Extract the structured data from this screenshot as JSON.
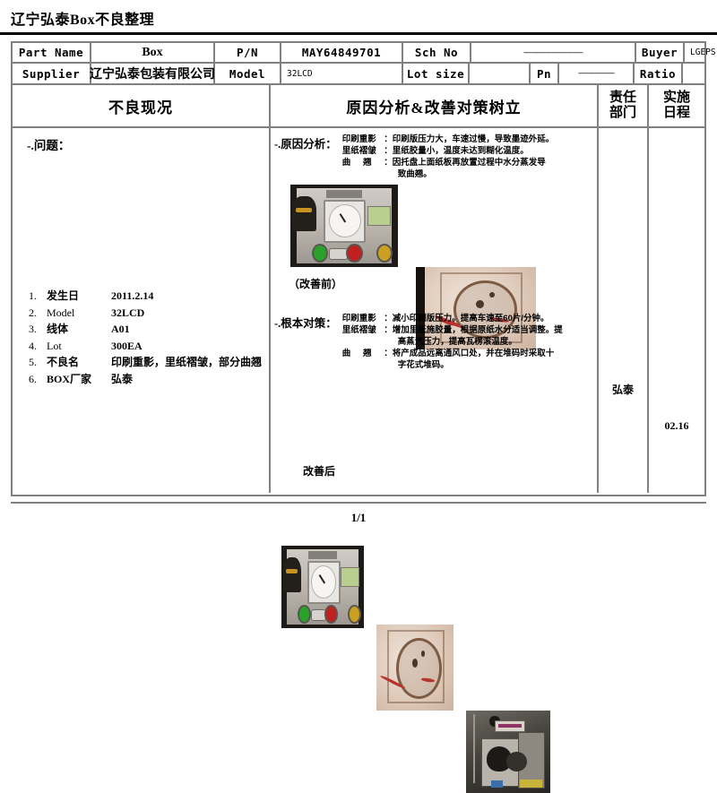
{
  "document": {
    "title": "辽宁弘泰Box不良整理",
    "page_number": "1/1"
  },
  "header": {
    "part_name_label": "Part Name",
    "part_name_value": "Box",
    "pn_label": "P/N",
    "pn_value": "MAY64849701",
    "sch_no_label": "Sch No",
    "sch_no_value": "—————",
    "buyer_label": "Buyer",
    "buyer_value": "LGEPS",
    "supplier_label": "Supplier",
    "supplier_value": "辽宁弘泰包装有限公司",
    "model_label": "Model",
    "model_value": "32LCD",
    "lot_size_label": "Lot size",
    "lot_size_value": "",
    "pn_qty_label": "Pn",
    "pn_qty_value": "———",
    "ratio_label": "Ratio",
    "ratio_value": ""
  },
  "sections": {
    "defect_status": "不良现况",
    "cause_and_countermeasure": "原因分析&改善对策树立",
    "responsible_department": "责任\n部门",
    "responsible_department_l1": "责任",
    "responsible_department_l2": "部门",
    "schedule": "实施\n日程",
    "schedule_l1": "实施",
    "schedule_l2": "日程"
  },
  "defect_status": {
    "heading": "-.问题：",
    "items": [
      {
        "index": "1.",
        "key": "发生日",
        "value": "2011.2.14"
      },
      {
        "index": "2.",
        "key": "Model",
        "value": "32LCD"
      },
      {
        "index": "3.",
        "key": "线体",
        "value": "A01"
      },
      {
        "index": "4.",
        "key": "Lot",
        "value": "300EA"
      },
      {
        "index": "5.",
        "key": "不良名",
        "value": "印刷重影，里纸褶皱，部分曲翘"
      },
      {
        "index": "6.",
        "key": "BOX厂家",
        "value": "弘泰"
      }
    ]
  },
  "cause_analysis": {
    "label": "-.原因分析：",
    "rows": [
      {
        "key_a": "印刷重影",
        "key_b": "",
        "colon": "：",
        "text": "印刷版压力大，车速过慢，导致墨迹外延。"
      },
      {
        "key_a": "里纸褶皱",
        "key_b": "",
        "colon": "：",
        "text": "里纸胶量小，温度未达到糊化温度。"
      },
      {
        "key_a": "曲",
        "key_b": "翘",
        "colon": "：",
        "text": "因托盘上面纸板再放置过程中水分蒸发导"
      }
    ],
    "continuation": "致曲翘。",
    "caption": "（改善前）"
  },
  "countermeasure": {
    "label": "-.根本对策：",
    "rows": [
      {
        "key_a": "印刷重影",
        "key_b": "",
        "colon": "：",
        "text": "减小印刷版压力。提高车速至60片/分钟。"
      },
      {
        "key_a": "里纸褶皱",
        "key_b": "",
        "colon": "：",
        "text": "增加里纸施胶量，根据原纸水分适当调整。提"
      },
      {
        "key_a": "曲",
        "key_b": "翘",
        "colon": "：",
        "text": "将产成品远离通风口处，并在堆码时采取十"
      }
    ],
    "continuation_1": "高蒸汽压力，提高瓦楞滚温度。",
    "continuation_2": "字花式堆码。",
    "caption": "改善后"
  },
  "photos": {
    "before": [
      {
        "name": "printing-machine-control-panel",
        "kind": "panel"
      },
      {
        "name": "cardboard-defect-closeup",
        "kind": "board"
      }
    ],
    "after": [
      {
        "name": "printing-machine-control-panel-after",
        "kind": "panel"
      },
      {
        "name": "cardboard-surface-after",
        "kind": "board"
      },
      {
        "name": "factory-workshop-stacking-area",
        "kind": "shop"
      }
    ]
  },
  "assignment": {
    "responsible": "弘泰",
    "date": "02.16"
  },
  "colors": {
    "grid": "#808080",
    "text": "#000000",
    "background": "#ffffff"
  }
}
